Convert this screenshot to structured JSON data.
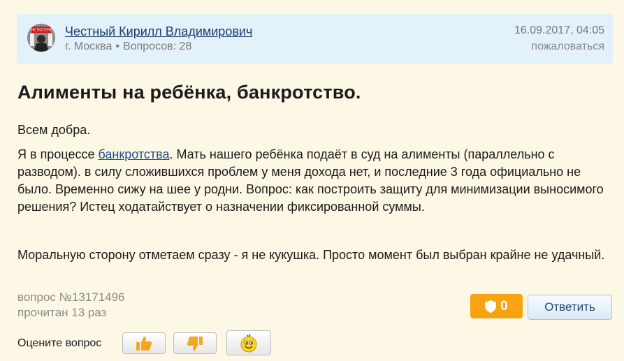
{
  "author": {
    "name": "Честный Кирилл Владимирович",
    "city": "г. Москва",
    "questions": "Вопросов: 28",
    "separator": "•",
    "date": "16.09.2017, 04:05",
    "report": "пожаловаться",
    "avatar_text": "НЕ ПОТЕРЯ"
  },
  "question": {
    "title": "Алименты на ребёнка, банкротство.",
    "greeting": "Всем добра.",
    "p2_before": "Я в процессе ",
    "p2_link": "банкротства",
    "p2_after": ". Мать нашего ребёнка подаёт в суд на алименты (параллельно с разводом). в силу сложившихся проблем у меня дохода нет, и последние 3 года официально не было. Временно сижу на шее у родни. Вопрос: как построить защиту для минимизации выносимого решения? Истец ходатайствует о назначении фиксированной суммы.",
    "p3": "Моральную сторону отметаем сразу - я не кукушка. Просто момент был выбран крайне не удачный.",
    "number": "вопрос №13171496",
    "reads": "прочитан 13 раз"
  },
  "actions": {
    "shield_count": "0",
    "answer_label": "Ответить",
    "rate_label": "Оцените вопрос"
  },
  "colors": {
    "accent_orange": "#f8a310",
    "link_blue": "#1e4f8c",
    "author_bg": "#e3f1fb",
    "page_bg": "#fdf8e6"
  },
  "icons": {
    "shield": "shield-icon",
    "like": "thumbs-up-icon",
    "dislike": "thumbs-down-icon",
    "smile": "smiley-icon"
  }
}
